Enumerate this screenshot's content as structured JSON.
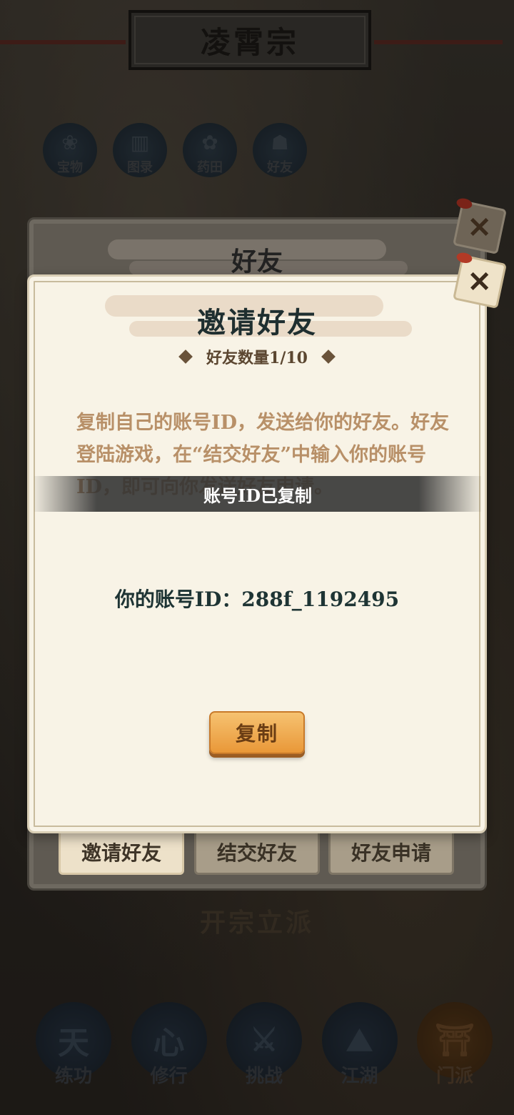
{
  "background": {
    "title": "凌霄宗",
    "top_icons": [
      {
        "label": "宝物",
        "icon": "treasure-icon",
        "glyph": "❀"
      },
      {
        "label": "图录",
        "icon": "book-icon",
        "glyph": "▥"
      },
      {
        "label": "药田",
        "icon": "herb-icon",
        "glyph": "✿"
      },
      {
        "label": "好友",
        "icon": "friends-icon",
        "glyph": "☗"
      }
    ],
    "caption": "开宗立派",
    "nav": [
      {
        "label": "练功",
        "icon": "training-icon",
        "glyph": "天"
      },
      {
        "label": "修行",
        "icon": "cultivation-icon",
        "glyph": "心"
      },
      {
        "label": "挑战",
        "icon": "challenge-icon",
        "glyph": "⚔"
      },
      {
        "label": "江湖",
        "icon": "jianghu-icon",
        "glyph": "⛰"
      },
      {
        "label": "门派",
        "icon": "sect-icon",
        "glyph": "⛩"
      }
    ]
  },
  "back_panel": {
    "title": "好友"
  },
  "dialog": {
    "title": "邀请好友",
    "friend_count": "好友数量1/10",
    "description": "复制自己的账号ID，发送给你的好友。好友登陆游戏，在“结交好友”中输入你的账号ID，即可向你发送好友申请。",
    "account_id_line": "你的账号ID：288f_1192495",
    "copy_button": "复制"
  },
  "toast": "账号ID已复制",
  "tabs": [
    {
      "label": "邀请好友",
      "active": true
    },
    {
      "label": "结交好友",
      "active": false
    },
    {
      "label": "好友申请",
      "active": false
    }
  ],
  "close_icon": "✕",
  "colors": {
    "dialog_bg": "#f8f3e6",
    "description_text": "#b89068",
    "button_orange": "#f0a94c",
    "toast_bg": "#303030"
  }
}
